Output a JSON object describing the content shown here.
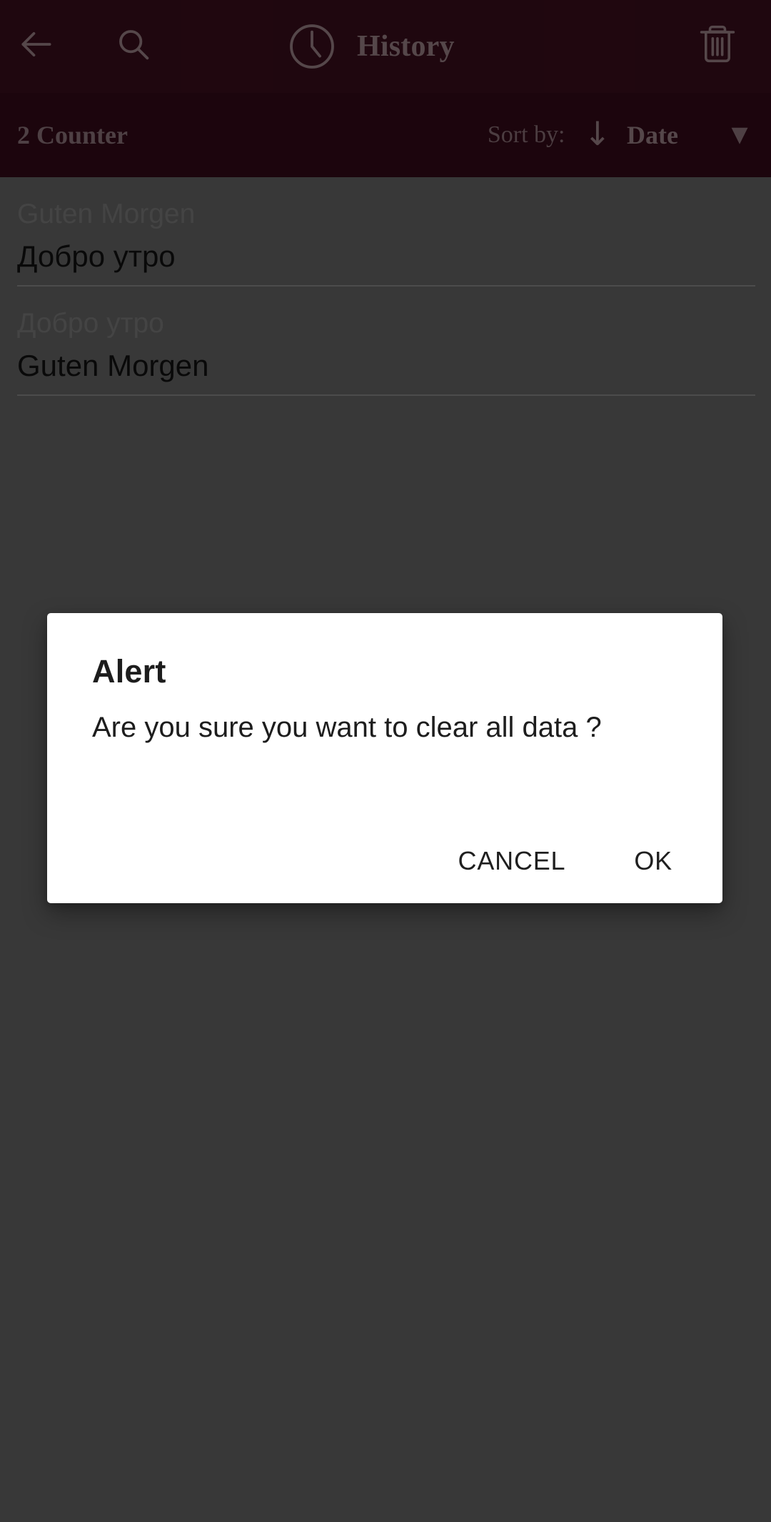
{
  "appbar": {
    "back_icon": "arrow-left-icon",
    "search_icon": "search-icon",
    "clock_icon": "clock-icon",
    "title": "History",
    "delete_icon": "trash-icon",
    "background_color": "#3a0d1c",
    "foreground_color": "#9b8188"
  },
  "sortbar": {
    "counter": "2 Counter",
    "sort_label": "Sort by:",
    "sort_direction_icon": "arrow-down-icon",
    "sort_direction": "↓",
    "sort_value": "Date",
    "caret_icon": "caret-down-icon",
    "caret": "▼",
    "background_color": "#330a18"
  },
  "history": {
    "items": [
      {
        "source": "Guten Morgen",
        "target": "Добро утро"
      },
      {
        "source": "Добро утро",
        "target": "Guten Morgen"
      }
    ]
  },
  "dialog": {
    "title": "Alert",
    "message": "Are you sure you want to clear all data ?",
    "cancel_label": "CANCEL",
    "ok_label": "OK",
    "background_color": "#ffffff",
    "text_color": "#1d1d1d"
  },
  "scrim": {
    "color": "#666666"
  }
}
